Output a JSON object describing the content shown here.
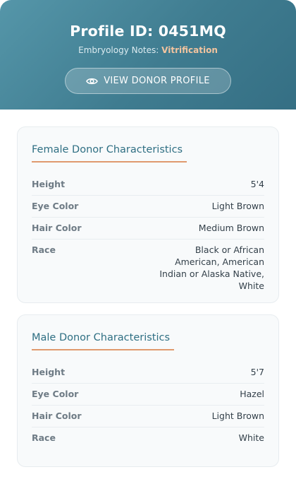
{
  "header": {
    "title": "Profile ID: 0451MQ",
    "notes_label": "Embryology Notes:",
    "notes_value": "Vitrification",
    "button_label": "VIEW DONOR PROFILE"
  },
  "female": {
    "title": "Female Donor Characteristics",
    "rows": [
      {
        "label": "Height",
        "value": "5'4"
      },
      {
        "label": "Eye Color",
        "value": "Light Brown"
      },
      {
        "label": "Hair Color",
        "value": "Medium Brown"
      },
      {
        "label": "Race",
        "value": "Black or African American, American Indian or Alaska Native, White"
      }
    ]
  },
  "male": {
    "title": "Male Donor Characteristics",
    "rows": [
      {
        "label": "Height",
        "value": "5'7"
      },
      {
        "label": "Eye Color",
        "value": "Hazel"
      },
      {
        "label": "Hair Color",
        "value": "Light Brown"
      },
      {
        "label": "Race",
        "value": "White"
      }
    ]
  },
  "colors": {
    "header_start": "#5596a9",
    "header_end": "#356f84",
    "accent": "#e09a6e",
    "title_text": "#2f6f83",
    "notes_highlight": "#f3c49f"
  },
  "icons": {
    "button_icon": "eye-icon"
  }
}
